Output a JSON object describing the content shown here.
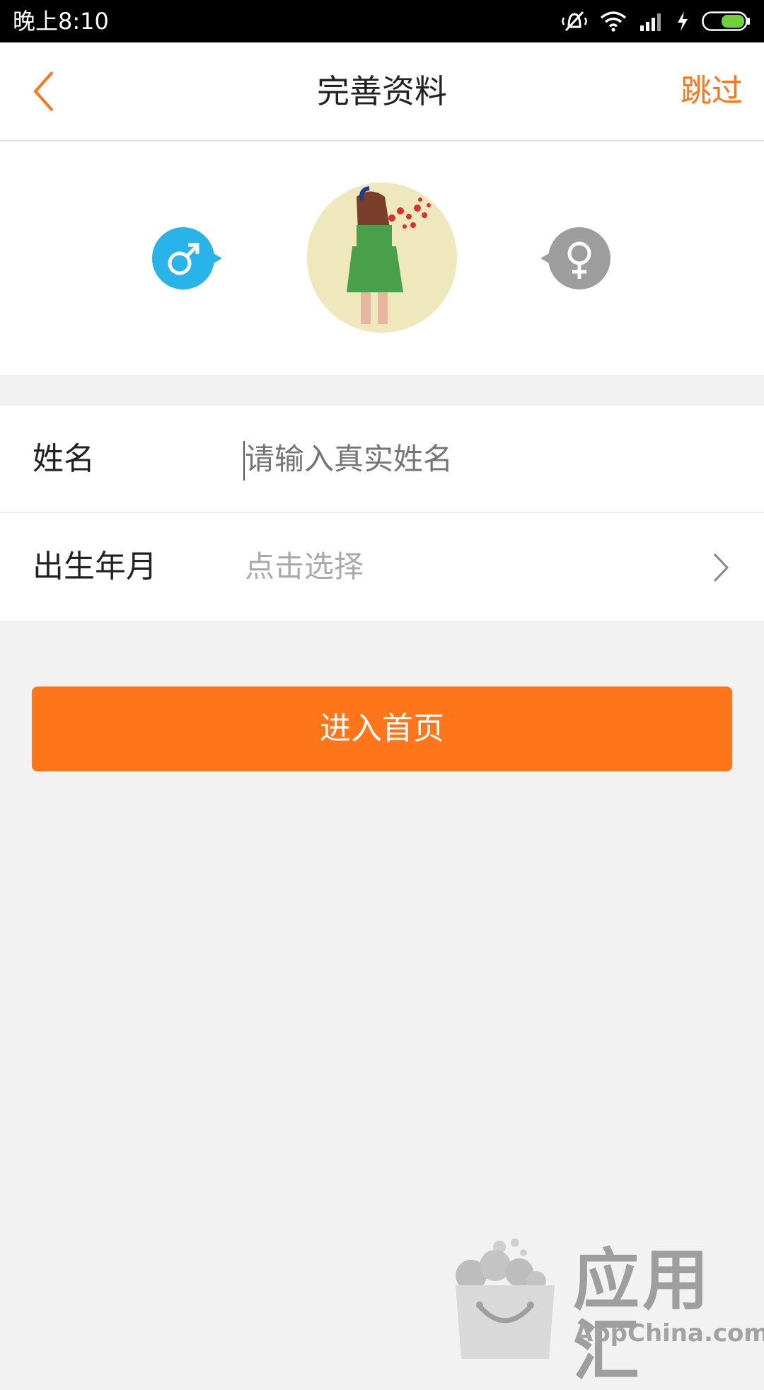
{
  "status_bar": {
    "time": "晚上8:10"
  },
  "header": {
    "title": "完善资料",
    "skip_label": "跳过",
    "back_icon": "chevron-left-icon",
    "accent_color": "#ff7519"
  },
  "profile": {
    "male_icon": "male-symbol-icon",
    "female_icon": "female-symbol-icon",
    "male_color": "#28b4e8",
    "female_color": "#9d9d9d"
  },
  "form": {
    "name_label": "姓名",
    "name_placeholder": "请输入真实姓名",
    "birth_label": "出生年月",
    "birth_value": "点击选择"
  },
  "enter_button": {
    "label": "进入首页"
  },
  "watermark": {
    "text": "应用汇",
    "subtext": "AppChina.com"
  }
}
